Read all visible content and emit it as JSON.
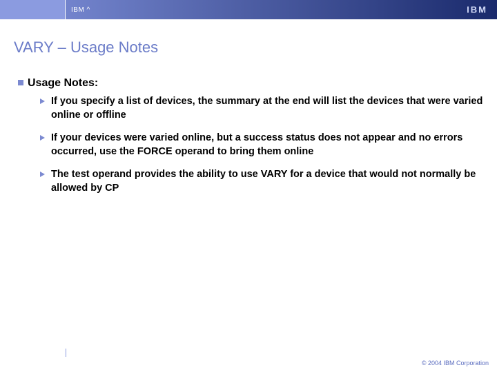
{
  "header": {
    "brand": "IBM ^",
    "logo": "IBM"
  },
  "slide": {
    "title": "VARY – Usage Notes"
  },
  "section": {
    "heading": "Usage Notes:",
    "bullets": [
      "If you specify a list of devices, the summary at the end will list the devices that were varied online or offline",
      "If your devices were varied online, but a success status does not appear and no errors occurred, use the FORCE operand to bring them online",
      "The test operand provides the ability to use VARY for a device that would not normally be allowed by CP"
    ]
  },
  "footer": {
    "copyright": "© 2004 IBM Corporation"
  }
}
